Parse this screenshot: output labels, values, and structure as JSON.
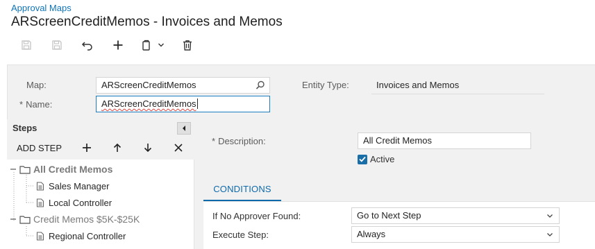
{
  "header": {
    "breadcrumb": "Approval Maps",
    "title": "ARScreenCreditMemos - Invoices and Memos"
  },
  "toolbar": {
    "icons": [
      "save-icon",
      "save-close-icon",
      "undo-icon",
      "add-icon",
      "copy-paste-icon",
      "delete-icon"
    ]
  },
  "form": {
    "map_label": "Map:",
    "map_value": "ARScreenCreditMemos",
    "name_required": "*",
    "name_label": "Name:",
    "name_value": "ARScreenCreditMemos",
    "entity_type_label": "Entity Type:",
    "entity_type_value": "Invoices and Memos"
  },
  "steps": {
    "title": "Steps",
    "add_step_label": "ADD STEP",
    "items": [
      {
        "label": "All Credit Memos",
        "type": "folder",
        "selected": true
      },
      {
        "label": "Sales Manager",
        "type": "rule"
      },
      {
        "label": "Local Controller",
        "type": "rule"
      },
      {
        "label": "Credit Memos $5K-$25K",
        "type": "folder"
      },
      {
        "label": "Regional Controller",
        "type": "rule"
      }
    ]
  },
  "details": {
    "description_required": "*",
    "description_label": "Description:",
    "description_value": "All Credit Memos",
    "active_label": "Active",
    "active_checked": true
  },
  "tabs": [
    {
      "label": "CONDITIONS",
      "active": true
    }
  ],
  "conditions": {
    "if_no_approver_label": "If No Approver Found:",
    "if_no_approver_value": "Go to Next Step",
    "execute_step_label": "Execute Step:",
    "execute_step_value": "Always"
  },
  "colors": {
    "accent": "#0e6aaa",
    "link": "#0e74b8",
    "panel_bg": "#f1f1f1",
    "checkbox": "#1a6ea8"
  }
}
